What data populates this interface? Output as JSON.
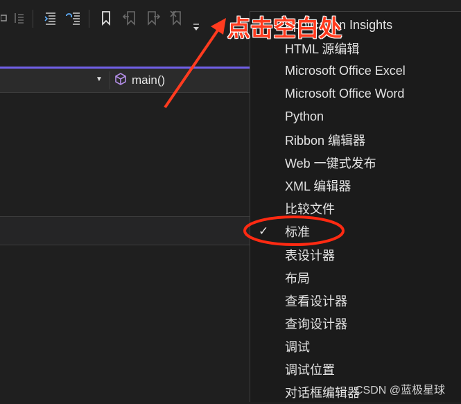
{
  "toolbar": {
    "buttons": [
      {
        "icon": "comment-out-icon"
      },
      {
        "icon": "uncomment-icon"
      },
      {
        "icon": "outdent-icon"
      },
      {
        "icon": "format-icon"
      },
      {
        "icon": "bookmark-icon"
      },
      {
        "icon": "prev-bookmark-icon"
      },
      {
        "icon": "next-bookmark-icon"
      },
      {
        "icon": "clear-bookmarks-icon"
      },
      {
        "icon": "overflow-dropdown-icon"
      }
    ]
  },
  "navbar": {
    "function_name": "main()",
    "function_icon": "cube-icon"
  },
  "menu": {
    "items": [
      {
        "label": "Application Insights",
        "checked": false
      },
      {
        "label": "HTML 源编辑",
        "checked": false
      },
      {
        "label": "Microsoft Office Excel",
        "checked": false
      },
      {
        "label": "Microsoft Office Word",
        "checked": false
      },
      {
        "label": "Python",
        "checked": false
      },
      {
        "label": "Ribbon 编辑器",
        "checked": false
      },
      {
        "label": "Web 一键式发布",
        "checked": false
      },
      {
        "label": "XML 编辑器",
        "checked": false
      },
      {
        "label": "比较文件",
        "checked": false
      },
      {
        "label": "标准",
        "checked": true
      },
      {
        "label": "表设计器",
        "checked": false
      },
      {
        "label": "布局",
        "checked": false
      },
      {
        "label": "查看设计器",
        "checked": false
      },
      {
        "label": "查询设计器",
        "checked": false
      },
      {
        "label": "调试",
        "checked": false
      },
      {
        "label": "调试位置",
        "checked": false
      },
      {
        "label": "对话框编辑器",
        "checked": false
      }
    ],
    "check_glyph": "✓"
  },
  "annotation": {
    "text": "点击空白处",
    "color": "#ff3b1f"
  },
  "watermark": "CSDN @蓝极星球"
}
